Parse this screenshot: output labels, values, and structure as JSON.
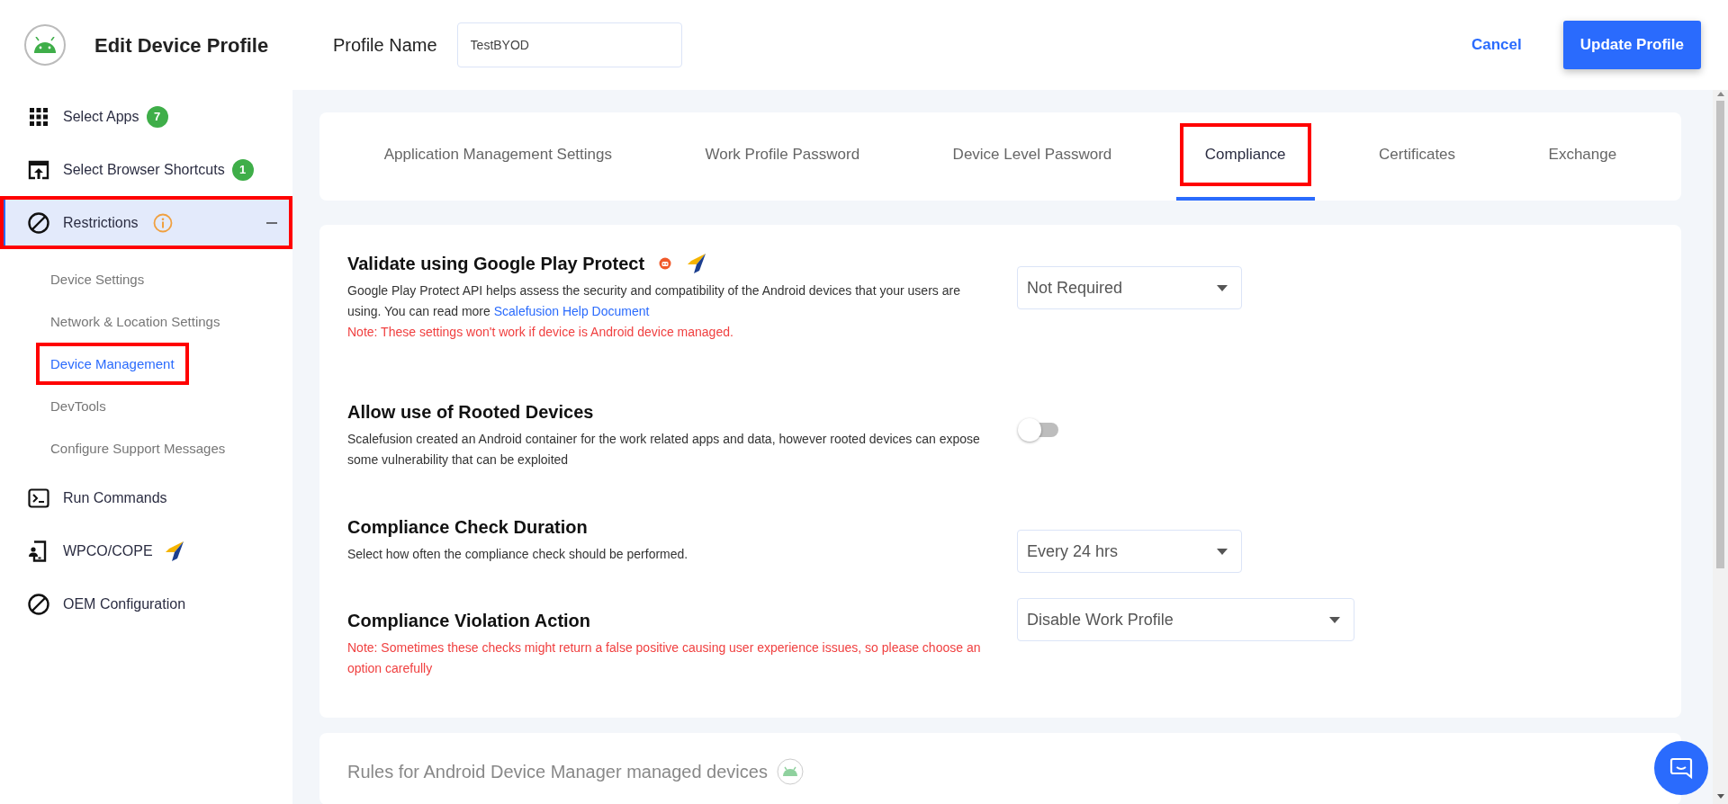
{
  "header": {
    "title": "Edit Device Profile",
    "profile_name_label": "Profile Name",
    "profile_name_value": "TestBYOD",
    "cancel": "Cancel",
    "update": "Update Profile"
  },
  "sidebar": {
    "items": [
      {
        "label": "Select Apps",
        "badge": "7",
        "selected": false,
        "highlighted": false
      },
      {
        "label": "Select Browser Shortcuts",
        "badge": "1",
        "selected": false,
        "highlighted": false
      },
      {
        "label": "Restrictions",
        "selected": true,
        "expanded": true,
        "highlighted": true,
        "children": [
          {
            "label": "Device Settings",
            "selected": false,
            "highlighted": false
          },
          {
            "label": "Network & Location Settings",
            "selected": false,
            "highlighted": false
          },
          {
            "label": "Device Management",
            "selected": true,
            "highlighted": true
          },
          {
            "label": "DevTools",
            "selected": false,
            "highlighted": false
          },
          {
            "label": "Configure Support Messages",
            "selected": false,
            "highlighted": false
          }
        ]
      },
      {
        "label": "Run Commands",
        "selected": false,
        "highlighted": false
      },
      {
        "label": "WPCO/COPE",
        "selected": false,
        "highlighted": false
      },
      {
        "label": "OEM Configuration",
        "selected": false,
        "highlighted": false
      }
    ]
  },
  "tabs": [
    {
      "label": "Application Management Settings",
      "selected": false,
      "highlighted": false
    },
    {
      "label": "Work Profile Password",
      "selected": false,
      "highlighted": false
    },
    {
      "label": "Device Level Password",
      "selected": false,
      "highlighted": false
    },
    {
      "label": "Compliance",
      "selected": true,
      "highlighted": true
    },
    {
      "label": "Certificates",
      "selected": false,
      "highlighted": false
    },
    {
      "label": "Exchange",
      "selected": false,
      "highlighted": false
    }
  ],
  "settings": [
    {
      "kind": "select",
      "title": "Validate using Google Play Protect",
      "description": "Google Play Protect API helps assess the security and compatibility of the Android devices that your users are using. You can read more ",
      "link": "Scalefusion Help Document",
      "note": "Note: These settings won't work if device is Android device managed.",
      "value": "Not Required"
    },
    {
      "kind": "toggle",
      "title": "Allow use of Rooted Devices",
      "description": "Scalefusion created an Android container for the work related apps and data, however rooted devices can expose some vulnerability that can be exploited",
      "on": false
    },
    {
      "kind": "select",
      "title": "Compliance Check Duration",
      "description": "Select how often the compliance check should be performed.",
      "value": "Every 24 hrs"
    },
    {
      "kind": "select",
      "title": "Compliance Violation Action",
      "note": "Note: Sometimes these checks might return a false positive causing user experience issues, so please choose an option carefully",
      "value": "Disable Work Profile"
    }
  ],
  "section2": {
    "title": "Rules for Android Device Manager managed devices"
  }
}
